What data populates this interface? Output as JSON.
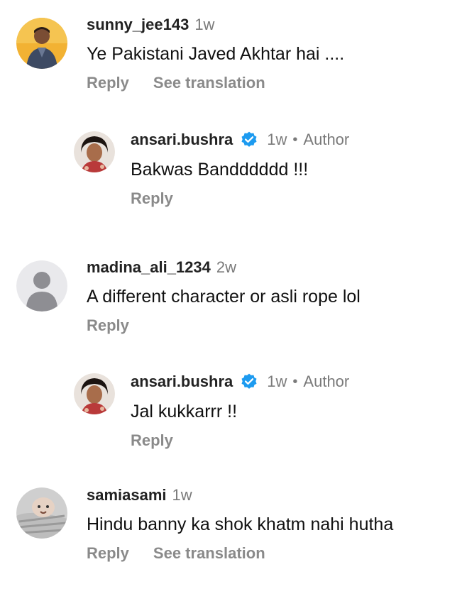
{
  "comments": [
    {
      "username": "sunny_jee143",
      "time": "1w",
      "text": "Ye Pakistani Javed Akhtar hai ....",
      "reply_label": "Reply",
      "translate_label": "See translation"
    },
    {
      "username": "ansari.bushra",
      "time": "1w",
      "separator": "•",
      "author_label": "Author",
      "text": "Bakwas Bandddddd !!!",
      "reply_label": "Reply"
    },
    {
      "username": "madina_ali_1234",
      "time": "2w",
      "text": "A different character or asli rope lol",
      "reply_label": "Reply"
    },
    {
      "username": "ansari.bushra",
      "time": "1w",
      "separator": "•",
      "author_label": "Author",
      "text": "Jal kukkarrr !!",
      "reply_label": "Reply"
    },
    {
      "username": "samiasami",
      "time": "1w",
      "text": "Hindu banny ka shok khatm nahi hutha",
      "reply_label": "Reply",
      "translate_label": "See translation"
    }
  ],
  "colors": {
    "verified_badge": "#1d9bf0",
    "meta_gray": "#7a7a7a",
    "action_gray": "#8a8a8a"
  }
}
